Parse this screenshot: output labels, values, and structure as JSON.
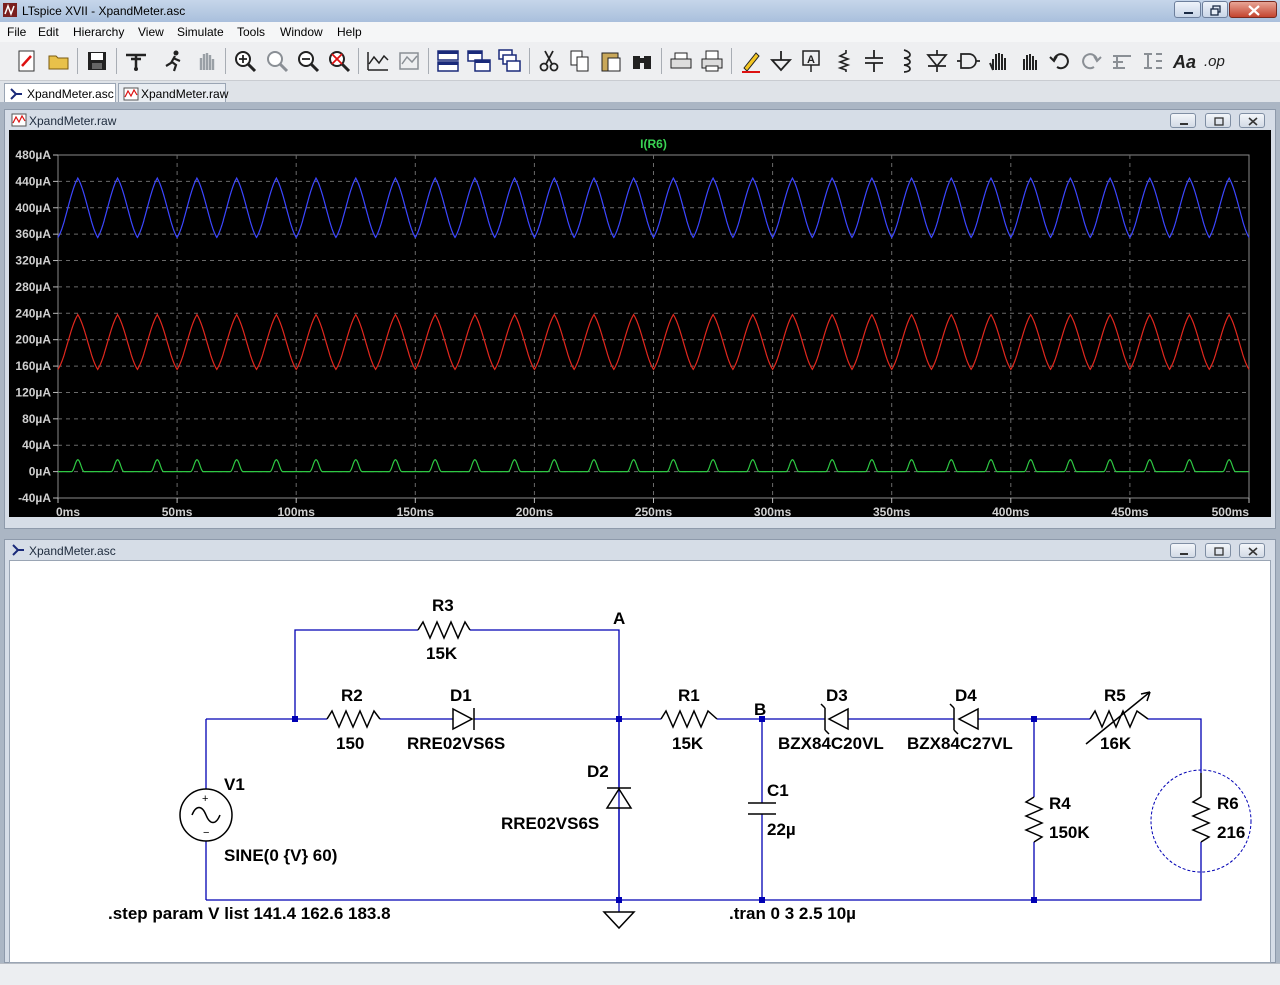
{
  "app": {
    "title": "LTspice XVII - XpandMeter.asc"
  },
  "menu": {
    "items": [
      "File",
      "Edit",
      "Hierarchy",
      "View",
      "Simulate",
      "Tools",
      "Window",
      "Help"
    ]
  },
  "tabs": [
    {
      "label": "XpandMeter.asc",
      "active": true
    },
    {
      "label": "XpandMeter.raw",
      "active": false
    }
  ],
  "waveform_window": {
    "title": "XpandMeter.raw",
    "trace_label": "I(R6)",
    "trace_label_color": "#39d353"
  },
  "schematic_window": {
    "title": "XpandMeter.asc",
    "components": {
      "R3": {
        "name": "R3",
        "value": "15K"
      },
      "R2": {
        "name": "R2",
        "value": "150"
      },
      "D1": {
        "name": "D1",
        "value": "RRE02VS6S"
      },
      "D2": {
        "name": "D2",
        "value": "RRE02VS6S"
      },
      "R1": {
        "name": "R1",
        "value": "15K"
      },
      "C1": {
        "name": "C1",
        "value": "22µ"
      },
      "D3": {
        "name": "D3",
        "value": "BZX84C20VL"
      },
      "D4": {
        "name": "D4",
        "value": "BZX84C27VL"
      },
      "R4": {
        "name": "R4",
        "value": "150K"
      },
      "R5": {
        "name": "R5",
        "value": "16K"
      },
      "R6": {
        "name": "R6",
        "value": "216"
      },
      "V1": {
        "name": "V1",
        "value": "SINE(0 {V} 60)"
      }
    },
    "nodes": {
      "A": "A",
      "B": "B"
    },
    "directives": {
      "step": ".step param V list 141.4 162.6 183.8",
      "tran": ".tran 0 3 2.5 10µ"
    },
    "wire_color": "#0000b4",
    "component_color": "#000000"
  },
  "chart_data": {
    "type": "line",
    "title": "I(R6)",
    "xlabel": "",
    "ylabel": "",
    "x_unit": "ms",
    "y_unit": "µA",
    "xlim": [
      0,
      500
    ],
    "ylim": [
      -40,
      480
    ],
    "x_ticks": [
      "0ms",
      "50ms",
      "100ms",
      "150ms",
      "200ms",
      "250ms",
      "300ms",
      "350ms",
      "400ms",
      "450ms",
      "500ms"
    ],
    "y_ticks": [
      "480µA",
      "440µA",
      "400µA",
      "360µA",
      "320µA",
      "280µA",
      "240µA",
      "200µA",
      "160µA",
      "120µA",
      "80µA",
      "40µA",
      "0µA",
      "-40µA"
    ],
    "grid": true,
    "period_ms": 16.667,
    "series": [
      {
        "color": "#3c46ff",
        "min": 355,
        "max": 445,
        "shape": "triangle-like"
      },
      {
        "color": "#e1281e",
        "min": 155,
        "max": 238,
        "shape": "triangle-like"
      },
      {
        "color": "#2ec843",
        "min": 0,
        "max": 18,
        "shape": "pulse"
      }
    ]
  }
}
